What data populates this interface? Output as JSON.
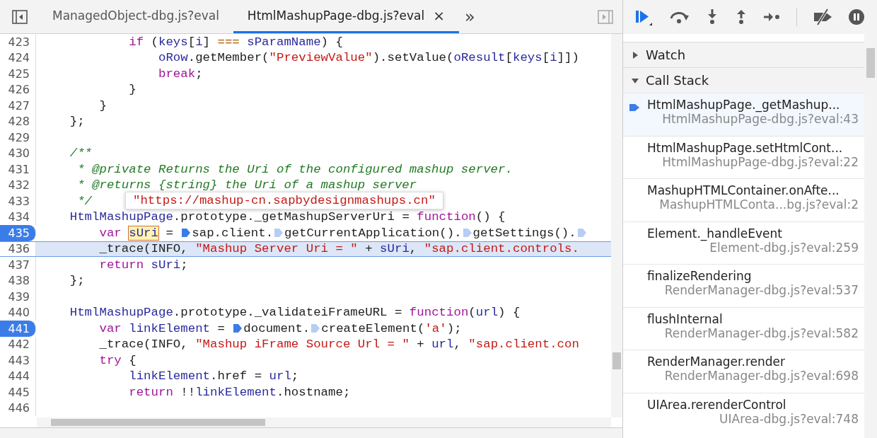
{
  "tabs": [
    {
      "label": "ManagedObject-dbg.js?eval",
      "selected": false
    },
    {
      "label": "HtmlMashupPage-dbg.js?eval",
      "selected": true,
      "close_icon": "×"
    }
  ],
  "more_tabs": "»",
  "code": [
    {
      "num": "423",
      "breakpoint": false,
      "current": false,
      "tokens": [
        {
          "kind": "kw",
          "text": "            if"
        },
        {
          "kind": "p",
          "text": " ("
        },
        {
          "kind": "id",
          "text": "keys"
        },
        {
          "kind": "p",
          "text": "["
        },
        {
          "kind": "id",
          "text": "i"
        },
        {
          "kind": "p",
          "text": "] "
        },
        {
          "kind": "op",
          "text": "==="
        },
        {
          "kind": "id",
          "text": " sParamName"
        },
        {
          "kind": "p",
          "text": ") {"
        }
      ]
    },
    {
      "num": "424",
      "breakpoint": false,
      "current": false,
      "tokens": [
        {
          "kind": "id",
          "text": "                oRow"
        },
        {
          "kind": "p",
          "text": ".getMember("
        },
        {
          "kind": "str",
          "text": "\"PreviewValue\""
        },
        {
          "kind": "p",
          "text": ").setValue("
        },
        {
          "kind": "id",
          "text": "oResult"
        },
        {
          "kind": "p",
          "text": "["
        },
        {
          "kind": "id",
          "text": "keys"
        },
        {
          "kind": "p",
          "text": "["
        },
        {
          "kind": "id",
          "text": "i"
        },
        {
          "kind": "p",
          "text": "]])"
        }
      ]
    },
    {
      "num": "425",
      "breakpoint": false,
      "current": false,
      "tokens": [
        {
          "kind": "kw",
          "text": "                break"
        },
        {
          "kind": "p",
          "text": ";"
        }
      ]
    },
    {
      "num": "426",
      "breakpoint": false,
      "current": false,
      "tokens": [
        {
          "kind": "p",
          "text": "            }"
        }
      ]
    },
    {
      "num": "427",
      "breakpoint": false,
      "current": false,
      "tokens": [
        {
          "kind": "p",
          "text": "        }"
        }
      ]
    },
    {
      "num": "428",
      "breakpoint": false,
      "current": false,
      "tokens": [
        {
          "kind": "p",
          "text": "    };"
        }
      ]
    },
    {
      "num": "429",
      "breakpoint": false,
      "current": false
    },
    {
      "num": "430",
      "breakpoint": false,
      "current": false,
      "tokens": [
        {
          "kind": "cmt",
          "text": "    /**"
        }
      ]
    },
    {
      "num": "431",
      "breakpoint": false,
      "current": false,
      "tokens": [
        {
          "kind": "cmt",
          "text": "     * @private Returns the Uri of the configured mashup server."
        }
      ]
    },
    {
      "num": "432",
      "breakpoint": false,
      "current": false,
      "tokens": [
        {
          "kind": "cmt",
          "text": "     * @returns {string} the Uri of a mashup server"
        }
      ]
    },
    {
      "num": "433",
      "breakpoint": false,
      "current": false,
      "tokens": [
        {
          "kind": "cmt",
          "text": "     */"
        }
      ]
    },
    {
      "num": "434",
      "breakpoint": false,
      "current": false,
      "tokens": [
        {
          "kind": "id",
          "text": "    HtmlMashupPage"
        },
        {
          "kind": "p",
          "text": ".prototype._getMashupServerUri = "
        },
        {
          "kind": "kw",
          "text": "function"
        },
        {
          "kind": "p",
          "text": "() {"
        }
      ]
    },
    {
      "num": "435",
      "breakpoint": true,
      "current": false,
      "tokens": [
        {
          "kind": "kw",
          "text": "        var "
        },
        {
          "kind": "var",
          "text": "sUri"
        },
        {
          "kind": "p",
          "text": " = "
        },
        {
          "kind": "mark",
          "active": true
        },
        {
          "kind": "p",
          "text": "sap.client."
        },
        {
          "kind": "mark",
          "active": false
        },
        {
          "kind": "p",
          "text": "getCurrentApplication()."
        },
        {
          "kind": "mark",
          "active": false
        },
        {
          "kind": "p",
          "text": "getSettings()."
        },
        {
          "kind": "mark",
          "active": false
        }
      ]
    },
    {
      "num": "436",
      "breakpoint": false,
      "current": true,
      "tokens": [
        {
          "kind": "p",
          "text": "        _trace(INFO, "
        },
        {
          "kind": "str",
          "text": "\"Mashup Server Uri = \""
        },
        {
          "kind": "p",
          "text": " + "
        },
        {
          "kind": "id",
          "text": "sUri"
        },
        {
          "kind": "p",
          "text": ", "
        },
        {
          "kind": "str",
          "text": "\"sap.client.controls."
        }
      ]
    },
    {
      "num": "437",
      "breakpoint": false,
      "current": false,
      "tokens": [
        {
          "kind": "kw",
          "text": "        return"
        },
        {
          "kind": "id",
          "text": " sUri"
        },
        {
          "kind": "p",
          "text": ";"
        }
      ]
    },
    {
      "num": "438",
      "breakpoint": false,
      "current": false,
      "tokens": [
        {
          "kind": "p",
          "text": "    };"
        }
      ]
    },
    {
      "num": "439",
      "breakpoint": false,
      "current": false
    },
    {
      "num": "440",
      "breakpoint": false,
      "current": false,
      "tokens": [
        {
          "kind": "id",
          "text": "    HtmlMashupPage"
        },
        {
          "kind": "p",
          "text": ".prototype._validateiFrameURL = "
        },
        {
          "kind": "kw",
          "text": "function"
        },
        {
          "kind": "p",
          "text": "("
        },
        {
          "kind": "id",
          "text": "url"
        },
        {
          "kind": "p",
          "text": ") {"
        }
      ]
    },
    {
      "num": "441",
      "breakpoint": true,
      "current": false,
      "tokens": [
        {
          "kind": "kw",
          "text": "        var"
        },
        {
          "kind": "id",
          "text": " linkElement"
        },
        {
          "kind": "p",
          "text": " = "
        },
        {
          "kind": "mark",
          "active": true
        },
        {
          "kind": "p",
          "text": "document."
        },
        {
          "kind": "mark",
          "active": false
        },
        {
          "kind": "p",
          "text": "createElement("
        },
        {
          "kind": "str",
          "text": "'a'"
        },
        {
          "kind": "p",
          "text": ");"
        }
      ]
    },
    {
      "num": "442",
      "breakpoint": false,
      "current": false,
      "tokens": [
        {
          "kind": "p",
          "text": "        _trace(INFO, "
        },
        {
          "kind": "str",
          "text": "\"Mashup iFrame Source Url = \""
        },
        {
          "kind": "p",
          "text": " + "
        },
        {
          "kind": "id",
          "text": "url"
        },
        {
          "kind": "p",
          "text": ", "
        },
        {
          "kind": "str",
          "text": "\"sap.client.con"
        }
      ]
    },
    {
      "num": "443",
      "breakpoint": false,
      "current": false,
      "tokens": [
        {
          "kind": "kw",
          "text": "        try"
        },
        {
          "kind": "p",
          "text": " {"
        }
      ]
    },
    {
      "num": "444",
      "breakpoint": false,
      "current": false,
      "tokens": [
        {
          "kind": "id",
          "text": "            linkElement"
        },
        {
          "kind": "p",
          "text": ".href = "
        },
        {
          "kind": "id",
          "text": "url"
        },
        {
          "kind": "p",
          "text": ";"
        }
      ]
    },
    {
      "num": "445",
      "breakpoint": false,
      "current": false,
      "tokens": [
        {
          "kind": "kw",
          "text": "            return"
        },
        {
          "kind": "p",
          "text": " !!"
        },
        {
          "kind": "id",
          "text": "linkElement"
        },
        {
          "kind": "p",
          "text": ".hostname;"
        }
      ]
    },
    {
      "num": "446",
      "breakpoint": false,
      "current": false
    }
  ],
  "tooltip": "\"https://mashup-cn.sapbydesignmashups.cn\"",
  "sections": [
    {
      "title": "Watch",
      "expanded": false
    },
    {
      "title": "Call Stack",
      "expanded": true
    }
  ],
  "call_stack": [
    {
      "name": "HtmlMashupPage._getMashup...",
      "location": "HtmlMashupPage-dbg.js?eval:43",
      "selected": true
    },
    {
      "name": "HtmlMashupPage.setHtmlCont...",
      "location": "HtmlMashupPage-dbg.js?eval:22",
      "selected": false
    },
    {
      "name": "MashupHTMLContainer.onAfte...",
      "location": "MashupHTMLConta...bg.js?eval:2",
      "selected": false
    },
    {
      "name": "Element._handleEvent",
      "location": "Element-dbg.js?eval:259",
      "selected": false
    },
    {
      "name": "finalizeRendering",
      "location": "RenderManager-dbg.js?eval:537",
      "selected": false
    },
    {
      "name": "flushInternal",
      "location": "RenderManager-dbg.js?eval:582",
      "selected": false
    },
    {
      "name": "RenderManager.render",
      "location": "RenderManager-dbg.js?eval:698",
      "selected": false
    },
    {
      "name": "UIArea.rerenderControl",
      "location": "UIArea-dbg.js?eval:748",
      "selected": false
    }
  ]
}
